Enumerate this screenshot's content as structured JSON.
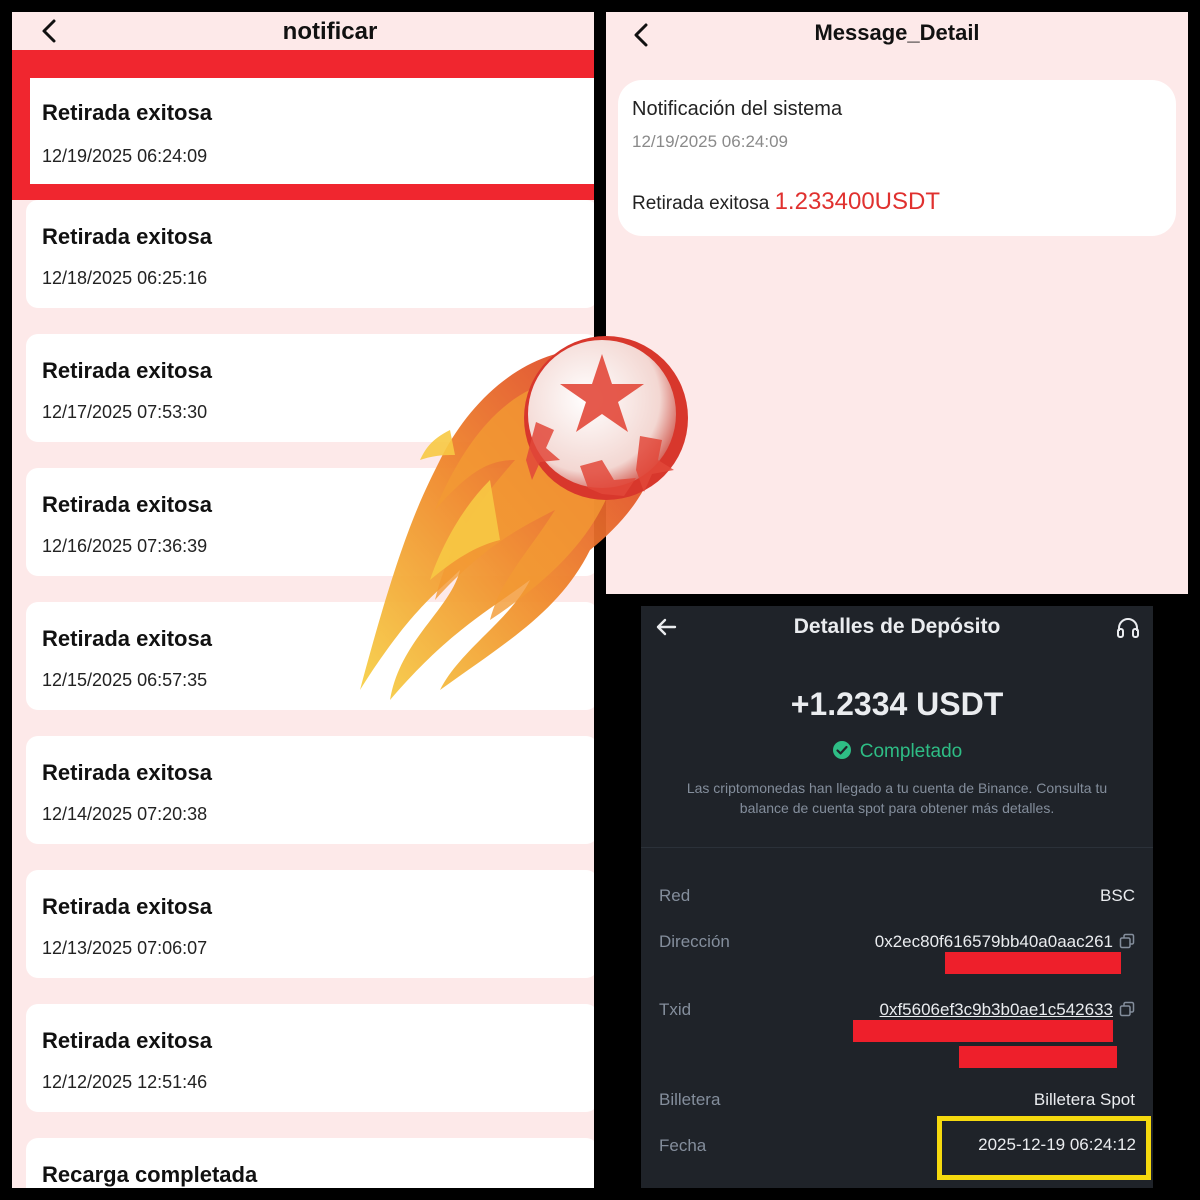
{
  "notifications_panel": {
    "title": "notificar",
    "items": [
      {
        "title": "Retirada exitosa",
        "date": "12/19/2025 06:24:09"
      },
      {
        "title": "Retirada exitosa",
        "date": "12/18/2025 06:25:16"
      },
      {
        "title": "Retirada exitosa",
        "date": "12/17/2025 07:53:30"
      },
      {
        "title": "Retirada exitosa",
        "date": "12/16/2025 07:36:39"
      },
      {
        "title": "Retirada exitosa",
        "date": "12/15/2025 06:57:35"
      },
      {
        "title": "Retirada exitosa",
        "date": "12/14/2025 07:20:38"
      },
      {
        "title": "Retirada exitosa",
        "date": "12/13/2025 07:06:07"
      },
      {
        "title": "Retirada exitosa",
        "date": "12/12/2025 12:51:46"
      },
      {
        "title": "Recarga completada",
        "date": ""
      }
    ]
  },
  "message_detail": {
    "title": "Message_Detail",
    "heading": "Notificación del sistema",
    "timestamp": "12/19/2025 06:24:09",
    "message_prefix": "Retirada exitosa",
    "amount": "1.233400USDT"
  },
  "deposit": {
    "title": "Detalles de Depósito",
    "amount": "+1.2334 USDT",
    "status": "Completado",
    "info": "Las criptomonedas han llegado a tu cuenta de Binance. Consulta tu balance de cuenta spot para obtener más detalles.",
    "rows": {
      "red_label": "Red",
      "red_value": "BSC",
      "direccion_label": "Dirección",
      "direccion_value": "0x2ec80f616579bb40a0aac261",
      "txid_label": "Txid",
      "txid_value": "0xf5606ef3c9b3b0ae1c542633",
      "billetera_label": "Billetera",
      "billetera_value": "Billetera Spot",
      "fecha_label": "Fecha",
      "fecha_value": "2025-12-19 06:24:12"
    }
  },
  "colors": {
    "app_bg": "#fde9e9",
    "highlight_red": "#f0262f",
    "amount_red": "#e0312f",
    "binance_bg": "#1f2329",
    "success_green": "#2ebd85",
    "highlight_yellow": "#f5d90e"
  },
  "icons": [
    "back-chevron-icon",
    "back-arrow-icon",
    "headset-icon",
    "check-circle-icon",
    "copy-icon",
    "fireball-icon"
  ]
}
